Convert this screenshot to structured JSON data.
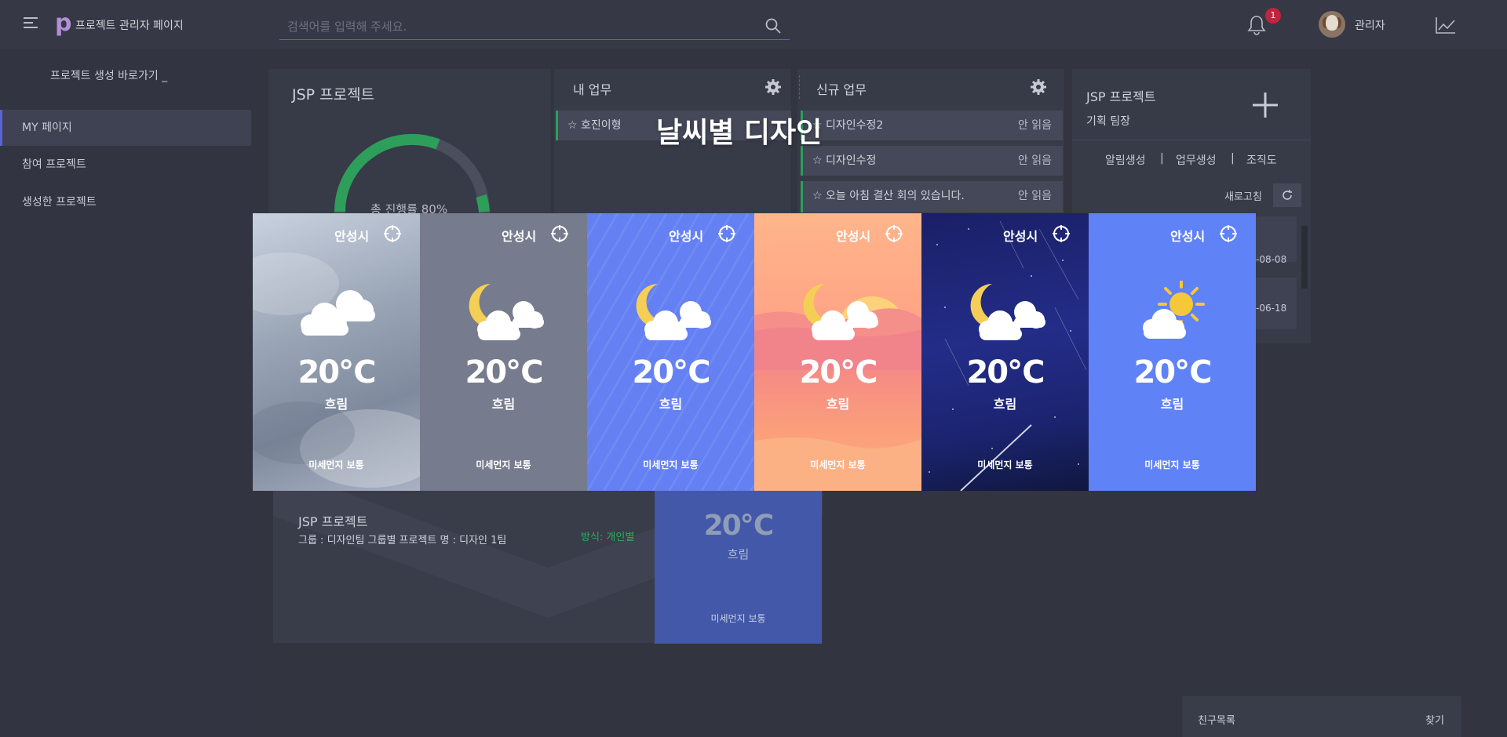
{
  "header": {
    "logo_text": "프로젝트 관리자 페이지",
    "search_placeholder": "검색어를 입력해 주세요.",
    "notification_count": "1",
    "user_name": "관리자"
  },
  "sidebar": {
    "shortcut": "프로젝트 생성 바로가기 _",
    "items": [
      {
        "label": "MY 페이지"
      },
      {
        "label": "참여 프로젝트"
      },
      {
        "label": "생성한 프로젝트"
      }
    ]
  },
  "project_panel": {
    "title": "JSP 프로젝트",
    "progress_text": "총 진행률 80%",
    "progress": 0.8
  },
  "my_tasks": {
    "title": "내 업무",
    "items": [
      {
        "label": "☆ 호진이형"
      }
    ]
  },
  "new_tasks": {
    "title": "신규 업무",
    "items": [
      {
        "label": "☆ 디자인수정2",
        "status": "안 읽음"
      },
      {
        "label": "☆ 디자인수정",
        "status": "안 읽음"
      },
      {
        "label": "☆ 오늘 아침 결산 회의 있습니다.",
        "status": "안 읽음"
      }
    ]
  },
  "right_panel": {
    "title": "JSP 프로젝트",
    "role": "기획 팀장",
    "links": [
      "알림생성",
      "업무생성",
      "조직도"
    ],
    "separator": "|",
    "refresh": "새로고침",
    "dates": [
      "-08-08",
      "-06-18"
    ]
  },
  "bottom_project": {
    "title": "JSP 프로젝트",
    "desc": "그룹 : 디자인팀 그룹별 프로젝트 명 : 디자인 1팀",
    "method": "방식: 개인별"
  },
  "friends": {
    "title": "친구목록",
    "find": "찾기"
  },
  "overlay": {
    "title": "날씨별 디자인",
    "cards": [
      {
        "theme": "cloudy",
        "city": "안성시",
        "temp": "20℃",
        "condition": "흐림",
        "dust": "미세먼지 보통",
        "bg": "#a9b2c2"
      },
      {
        "theme": "night-gray",
        "city": "안성시",
        "temp": "20℃",
        "condition": "흐림",
        "dust": "미세먼지 보통",
        "bg": "#757a8c"
      },
      {
        "theme": "rain-blue",
        "city": "안성시",
        "temp": "20℃",
        "condition": "흐림",
        "dust": "미세먼지 보통",
        "bg": "#6480f2"
      },
      {
        "theme": "sunset",
        "city": "안성시",
        "temp": "20℃",
        "condition": "흐림",
        "dust": "미세먼지 보통",
        "bg": "#fca28a"
      },
      {
        "theme": "starry-night",
        "city": "안성시",
        "temp": "20℃",
        "condition": "흐림",
        "dust": "미세먼지 보통",
        "bg": "#1b2470"
      },
      {
        "theme": "sunny",
        "city": "안성시",
        "temp": "20℃",
        "condition": "흐림",
        "dust": "미세먼지 보통",
        "bg": "#5f82f7"
      }
    ],
    "behind_card": {
      "temp": "20℃",
      "condition": "흐림",
      "dust": "미세먼지 보통"
    }
  }
}
